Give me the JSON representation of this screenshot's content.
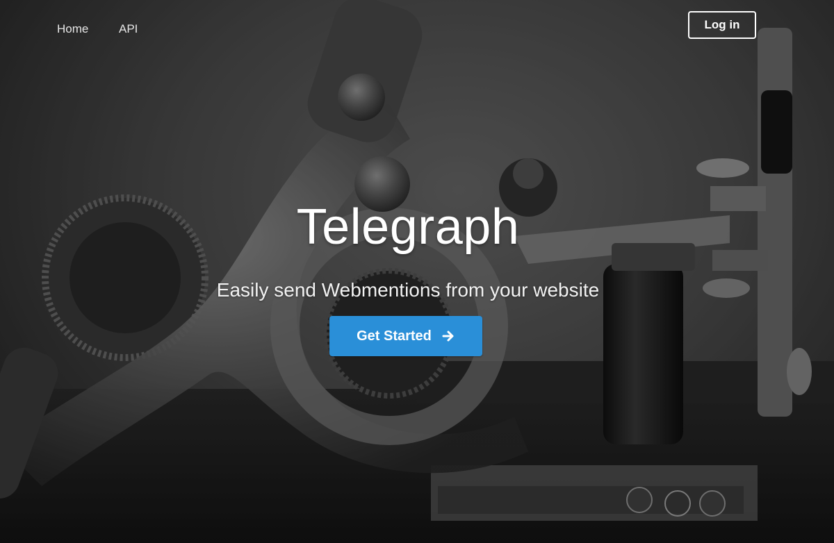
{
  "nav": {
    "items": [
      {
        "label": "Home"
      },
      {
        "label": "API"
      }
    ],
    "login_label": "Log in"
  },
  "hero": {
    "title": "Telegraph",
    "subtitle": "Easily send Webmentions from your website",
    "cta_label": "Get Started",
    "cta_icon": "arrow-right-icon",
    "background": "grayscale photo of antique telegraph machine"
  },
  "colors": {
    "accent": "#2a8fd8",
    "text": "#ffffff"
  }
}
